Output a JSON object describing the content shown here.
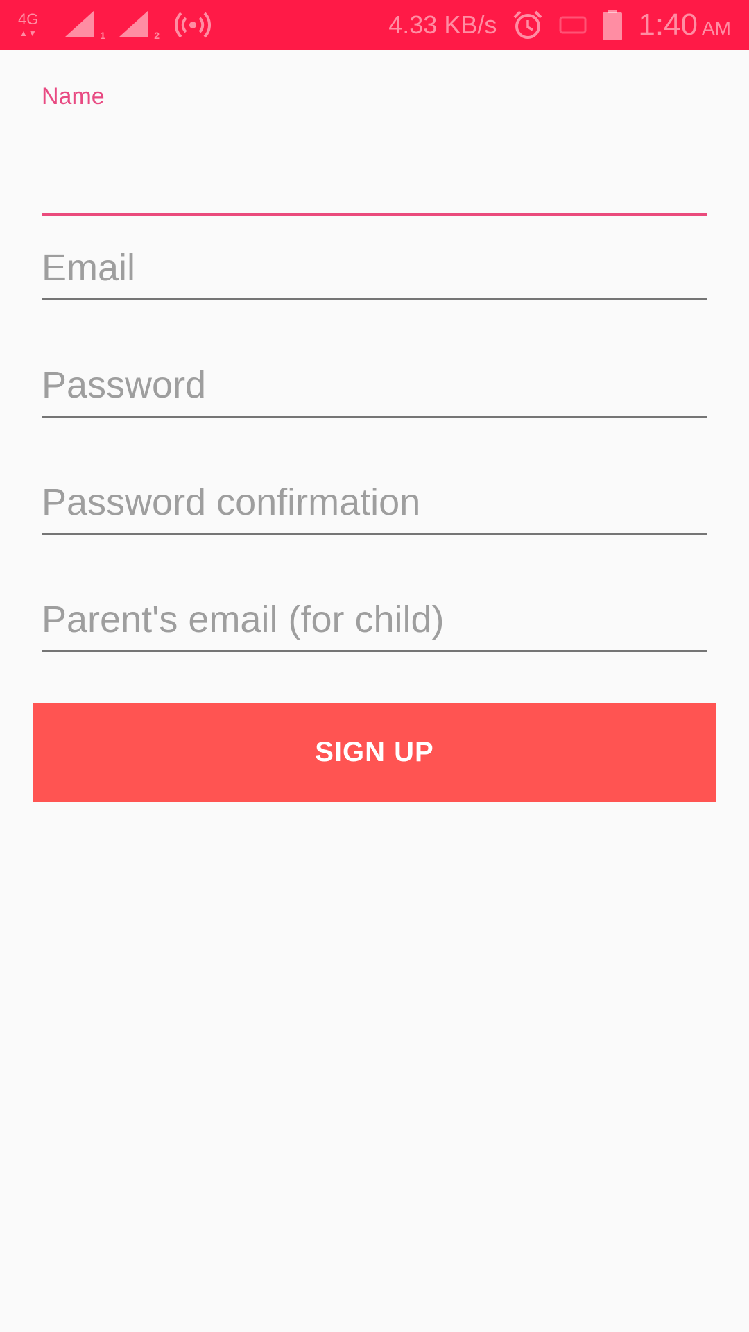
{
  "status_bar": {
    "network_type": "4G",
    "sim1_index": "1",
    "sim2_index": "2",
    "data_speed": "4.33 KB/s",
    "time": "1:40",
    "ampm": "AM",
    "background_color": "#ff1a47",
    "icons": [
      "signal-icon",
      "signal-icon",
      "hotspot-icon",
      "alarm-icon",
      "sim-icon",
      "battery-icon"
    ]
  },
  "form": {
    "name": {
      "label": "Name",
      "value": "",
      "focused": true,
      "accent_color": "#ea4b7c"
    },
    "email": {
      "placeholder": "Email",
      "value": ""
    },
    "password": {
      "placeholder": "Password",
      "value": ""
    },
    "password_confirmation": {
      "placeholder": "Password confirmation",
      "value": ""
    },
    "parent_email": {
      "placeholder": "Parent's email (for child)",
      "value": ""
    }
  },
  "signup_button": {
    "label": "SIGN UP",
    "color": "#ff5452"
  }
}
